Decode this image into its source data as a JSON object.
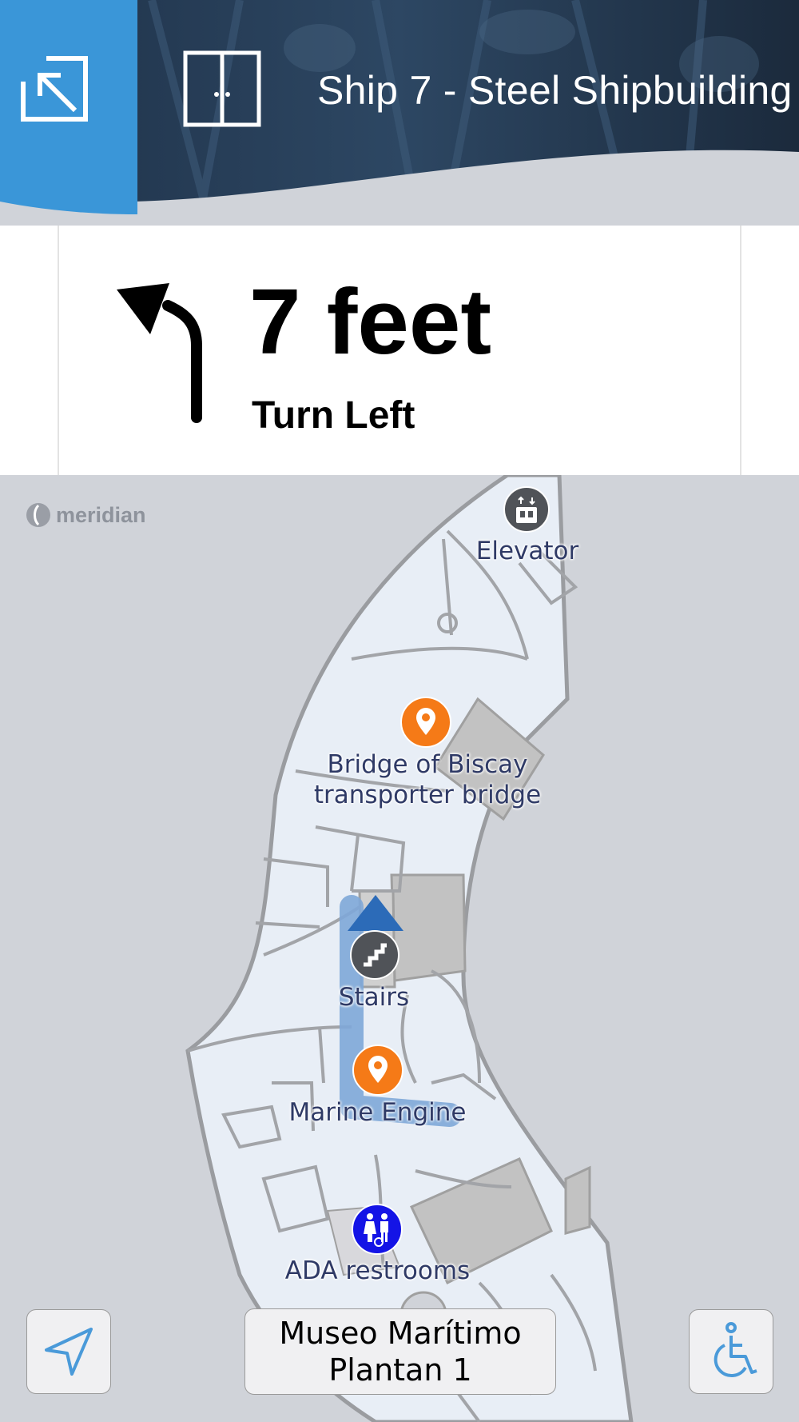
{
  "header": {
    "title": "Ship 7 - Steel Shipbuilding",
    "exit_icon": "exit-fullscreen-arrow-icon",
    "doors_icon": "double-door-icon",
    "accent_color": "#3a96d8"
  },
  "directions": {
    "distance": "7 feet",
    "instruction": "Turn Left",
    "turn_icon": "turn-left-arrow-icon"
  },
  "map": {
    "brand": "meridian",
    "pois": [
      {
        "label": "Elevator",
        "icon": "elevator-icon",
        "color": "#505358"
      },
      {
        "label_lines": [
          "Bridge of Biscay",
          "transporter bridge"
        ],
        "icon": "map-pin-icon",
        "color": "#f57a17"
      },
      {
        "label": "Stairs",
        "icon": "stairs-icon",
        "color": "#505358"
      },
      {
        "label": "Marine Engine",
        "icon": "map-pin-icon",
        "color": "#f57a17"
      },
      {
        "label": "ADA restrooms",
        "icon": "restroom-icon",
        "color": "#1414e6"
      }
    ],
    "route_color": "#7ea7d8",
    "position_color": "#2c6bb8"
  },
  "controls": {
    "locate_icon": "location-arrow-icon",
    "floor_line1": "Museo Marítimo",
    "floor_line2": "Plantan 1",
    "accessibility_icon": "wheelchair-icon"
  }
}
